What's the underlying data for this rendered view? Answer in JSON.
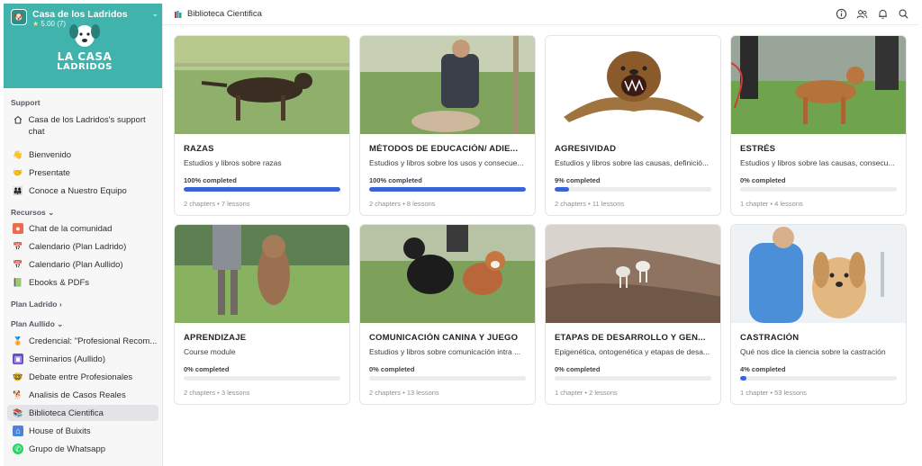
{
  "community": {
    "name": "Casa de los Ladridos",
    "rating": "5.00",
    "rating_count": "(7)",
    "logo_line1": "LA CASA",
    "logo_line2": "LADRIDOS"
  },
  "sidebar": {
    "support_heading": "Support",
    "support_chat": "Casa de los Ladridos's support chat",
    "general": [
      {
        "label": "Bienvenido",
        "icon": "waving-hand-icon"
      },
      {
        "label": "Presentate",
        "icon": "handshake-icon"
      },
      {
        "label": "Conoce a Nuestro Equipo",
        "icon": "team-icon"
      }
    ],
    "recursos_heading": "Recursos",
    "recursos": [
      {
        "label": "Chat de la comunidad",
        "icon": "chat-icon"
      },
      {
        "label": "Calendario (Plan Ladrido)",
        "icon": "calendar-icon"
      },
      {
        "label": "Calendario (Plan Aullido)",
        "icon": "calendar-icon"
      },
      {
        "label": "Ebooks & PDFs",
        "icon": "book-icon"
      }
    ],
    "plan_ladrido_heading": "Plan Ladrido",
    "plan_aullido_heading": "Plan Aullido",
    "aullido": [
      {
        "label": "Credencial: \"Profesional Recom...",
        "icon": "badge-icon"
      },
      {
        "label": "Seminarios (Aullido)",
        "icon": "seminar-icon"
      },
      {
        "label": "Debate entre Profesionales",
        "icon": "debate-icon"
      },
      {
        "label": "Analisis de Casos Reales",
        "icon": "dog-icon"
      },
      {
        "label": "Biblioteca Cientifica",
        "icon": "books-icon"
      },
      {
        "label": "House of Buixits",
        "icon": "house-icon"
      },
      {
        "label": "Grupo de Whatsapp",
        "icon": "whatsapp-icon"
      }
    ]
  },
  "header": {
    "breadcrumb": "Biblioteca Cientifica",
    "icons": [
      "info-icon",
      "members-icon",
      "bell-icon",
      "search-icon"
    ]
  },
  "courses": [
    {
      "title": "RAZAS",
      "desc": "Estudios y libros sobre razas",
      "progress_label": "100% completed",
      "progress": 100,
      "chapters": "2 chapters",
      "lessons": "7 lessons"
    },
    {
      "title": "MÉTODOS DE EDUCACIÓN/ ADIE...",
      "desc": "Estudios y libros sobre los usos y consecue...",
      "progress_label": "100% completed",
      "progress": 100,
      "chapters": "2 chapters",
      "lessons": "8 lessons"
    },
    {
      "title": "AGRESIVIDAD",
      "desc": "Estudios y libros sobre las causas, definició...",
      "progress_label": "9% completed",
      "progress": 9,
      "chapters": "2 chapters",
      "lessons": "11 lessons"
    },
    {
      "title": "ESTRÉS",
      "desc": "Estudios y libros sobre las causas, consecu...",
      "progress_label": "0% completed",
      "progress": 0,
      "chapters": "1 chapter",
      "lessons": "4 lessons"
    },
    {
      "title": "APRENDIZAJE",
      "desc": "Course module",
      "progress_label": "0% completed",
      "progress": 0,
      "chapters": "2 chapters",
      "lessons": "3 lessons"
    },
    {
      "title": "COMUNICACIÓN CANINA Y JUEGO",
      "desc": "Estudios y libros sobre comunicación intra ...",
      "progress_label": "0% completed",
      "progress": 0,
      "chapters": "2 chapters",
      "lessons": "13 lessons"
    },
    {
      "title": "ETAPAS DE DESARROLLO Y GEN...",
      "desc": "Epigenética, ontogenética y etapas de desa...",
      "progress_label": "0% completed",
      "progress": 0,
      "chapters": "1 chapter",
      "lessons": "2 lessons"
    },
    {
      "title": "CASTRACIÓN",
      "desc": "Qué nos dice la ciencia sobre la castración",
      "progress_label": "4% completed",
      "progress": 4,
      "chapters": "1 chapter",
      "lessons": "53 lessons"
    }
  ],
  "colors": {
    "brand": "#3fb3ac",
    "progress": "#3a63d8"
  }
}
